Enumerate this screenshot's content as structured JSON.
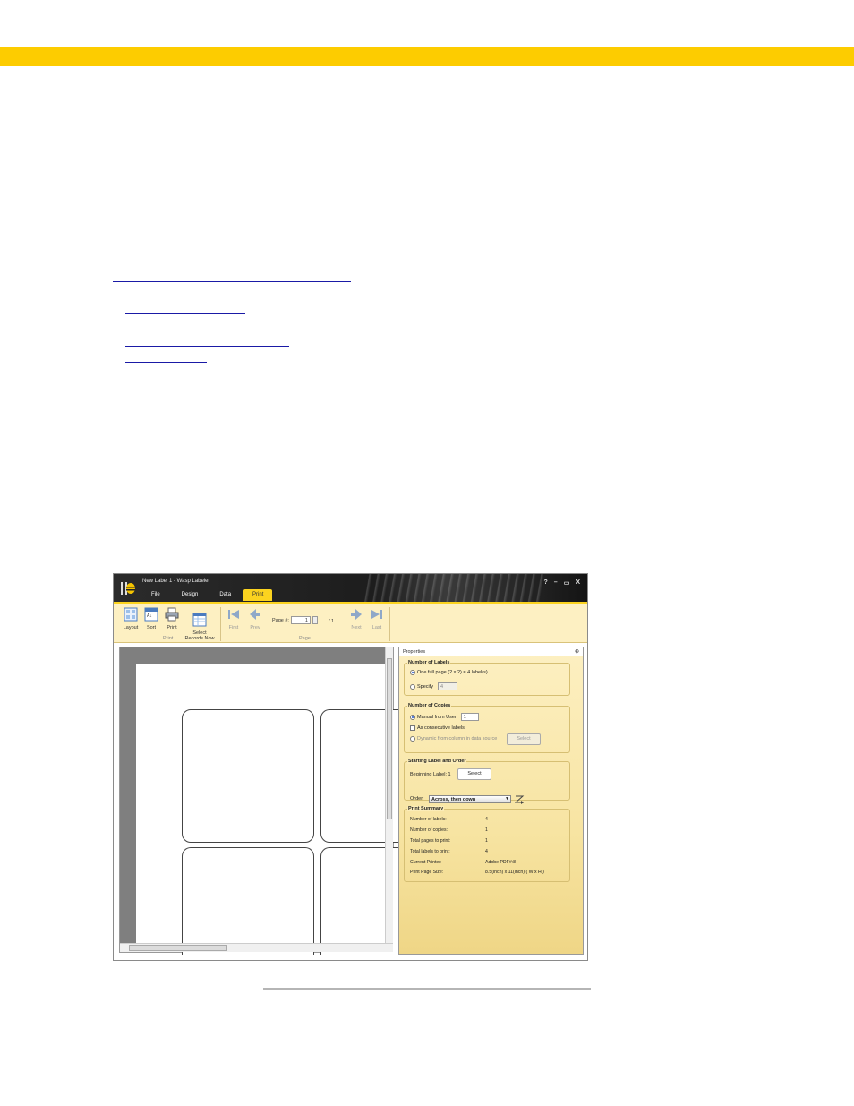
{
  "colors": {
    "accent": "#fdcc00",
    "link": "#1a1aa6",
    "ribbon_active": "#fbd31f"
  },
  "app": {
    "title": "New Label 1 - Wasp Labeler",
    "window_controls": [
      "?",
      "–",
      "▭",
      "X"
    ],
    "tabs": [
      {
        "label": "File",
        "active": false
      },
      {
        "label": "Design",
        "active": false
      },
      {
        "label": "Data",
        "active": false
      },
      {
        "label": "Print",
        "active": true
      }
    ],
    "ribbon": {
      "print_group": {
        "label": "Print",
        "buttons": [
          {
            "label": "Layout",
            "icon": "layout-icon"
          },
          {
            "label": "Sort",
            "icon": "sort-icon"
          },
          {
            "label": "Print",
            "icon": "printer-icon"
          },
          {
            "label": "Select\nRecords Now",
            "icon": "select-records-icon"
          }
        ]
      },
      "page_group": {
        "label": "Page",
        "first": "First",
        "prev": "Prev",
        "next": "Next",
        "last": "Last",
        "page_label": "Page #:",
        "page_value": "1",
        "page_total": "/ 1"
      }
    },
    "properties": {
      "title": "Properties",
      "number_of_labels": {
        "title": "Number of Labels",
        "option_full_page": "One full page (2 x 2) = 4 label(s)",
        "option_specify": "Specify",
        "specify_value": "4"
      },
      "number_of_copies": {
        "title": "Number of Copies",
        "manual": "Manual from User",
        "manual_value": "1",
        "consecutive": "As consecutive labels",
        "dynamic": "Dynamic from column in data source",
        "select_label": "Select"
      },
      "starting_label": {
        "title": "Starting Label and Order",
        "beginning_label": "Beginning Label: 1",
        "select_label": "Select",
        "order_label": "Order:",
        "order_value": "Across, then down"
      },
      "print_summary": {
        "title": "Print Summary",
        "rows": [
          {
            "label": "Number of labels:",
            "value": "4"
          },
          {
            "label": "Number of copies:",
            "value": "1"
          },
          {
            "label": "Total pages to print:",
            "value": "1"
          },
          {
            "label": "Total labels to print:",
            "value": "4"
          },
          {
            "label": "Current Printer:",
            "value": "Adobe PDF#:8"
          },
          {
            "label": "Print Page Size:",
            "value": "8.5(inch) x 11(inch) ( W x H )"
          }
        ]
      }
    }
  }
}
